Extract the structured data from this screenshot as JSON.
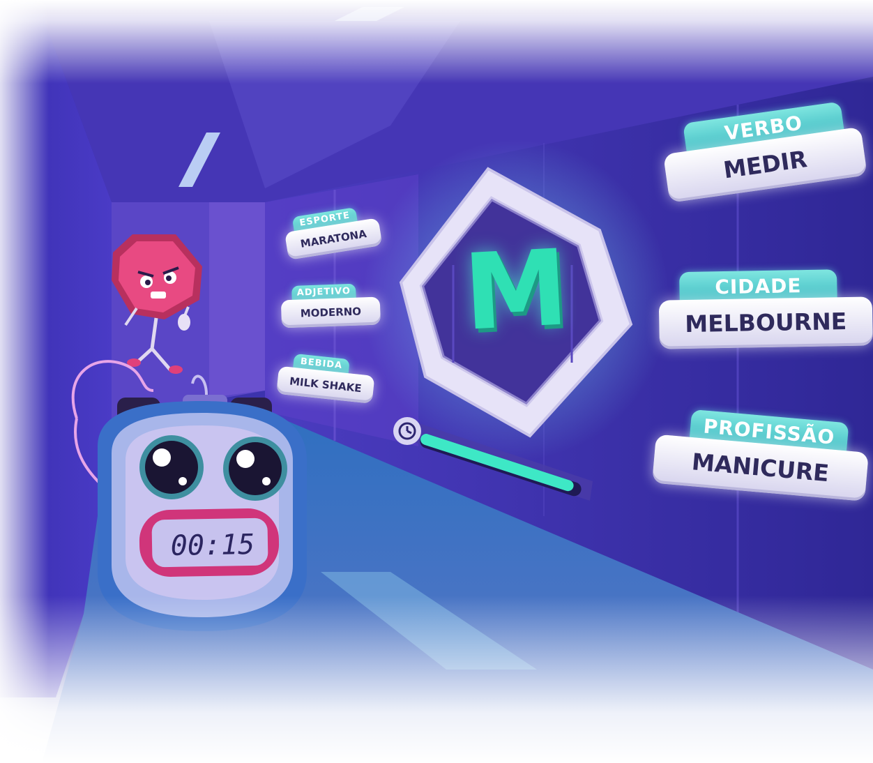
{
  "letter": "M",
  "timer": {
    "display": "00:15",
    "progress": 0.95,
    "icon": "clock-icon"
  },
  "categories_left": [
    {
      "category": "ESPORTE",
      "answer": "MARATONA"
    },
    {
      "category": "ADJETIVO",
      "answer": "MODERNO"
    },
    {
      "category": "BEBIDA",
      "answer": "MILK SHAKE"
    }
  ],
  "categories_right": [
    {
      "category": "VERBO",
      "answer": "MEDIR"
    },
    {
      "category": "CIDADE",
      "answer": "MELBOURNE"
    },
    {
      "category": "PROFISSÃO",
      "answer": "MANICURE"
    }
  ],
  "characters": [
    "angry-stop-sign-mascot",
    "alarm-clock-mascot"
  ],
  "colors": {
    "background": "#3a2aa8",
    "accent_teal": "#3cb9c2",
    "letter_green": "#2fe0b4",
    "mascot_pink": "#e0407a",
    "plate": "#f1effa",
    "text_dark": "#2f2a5c"
  }
}
